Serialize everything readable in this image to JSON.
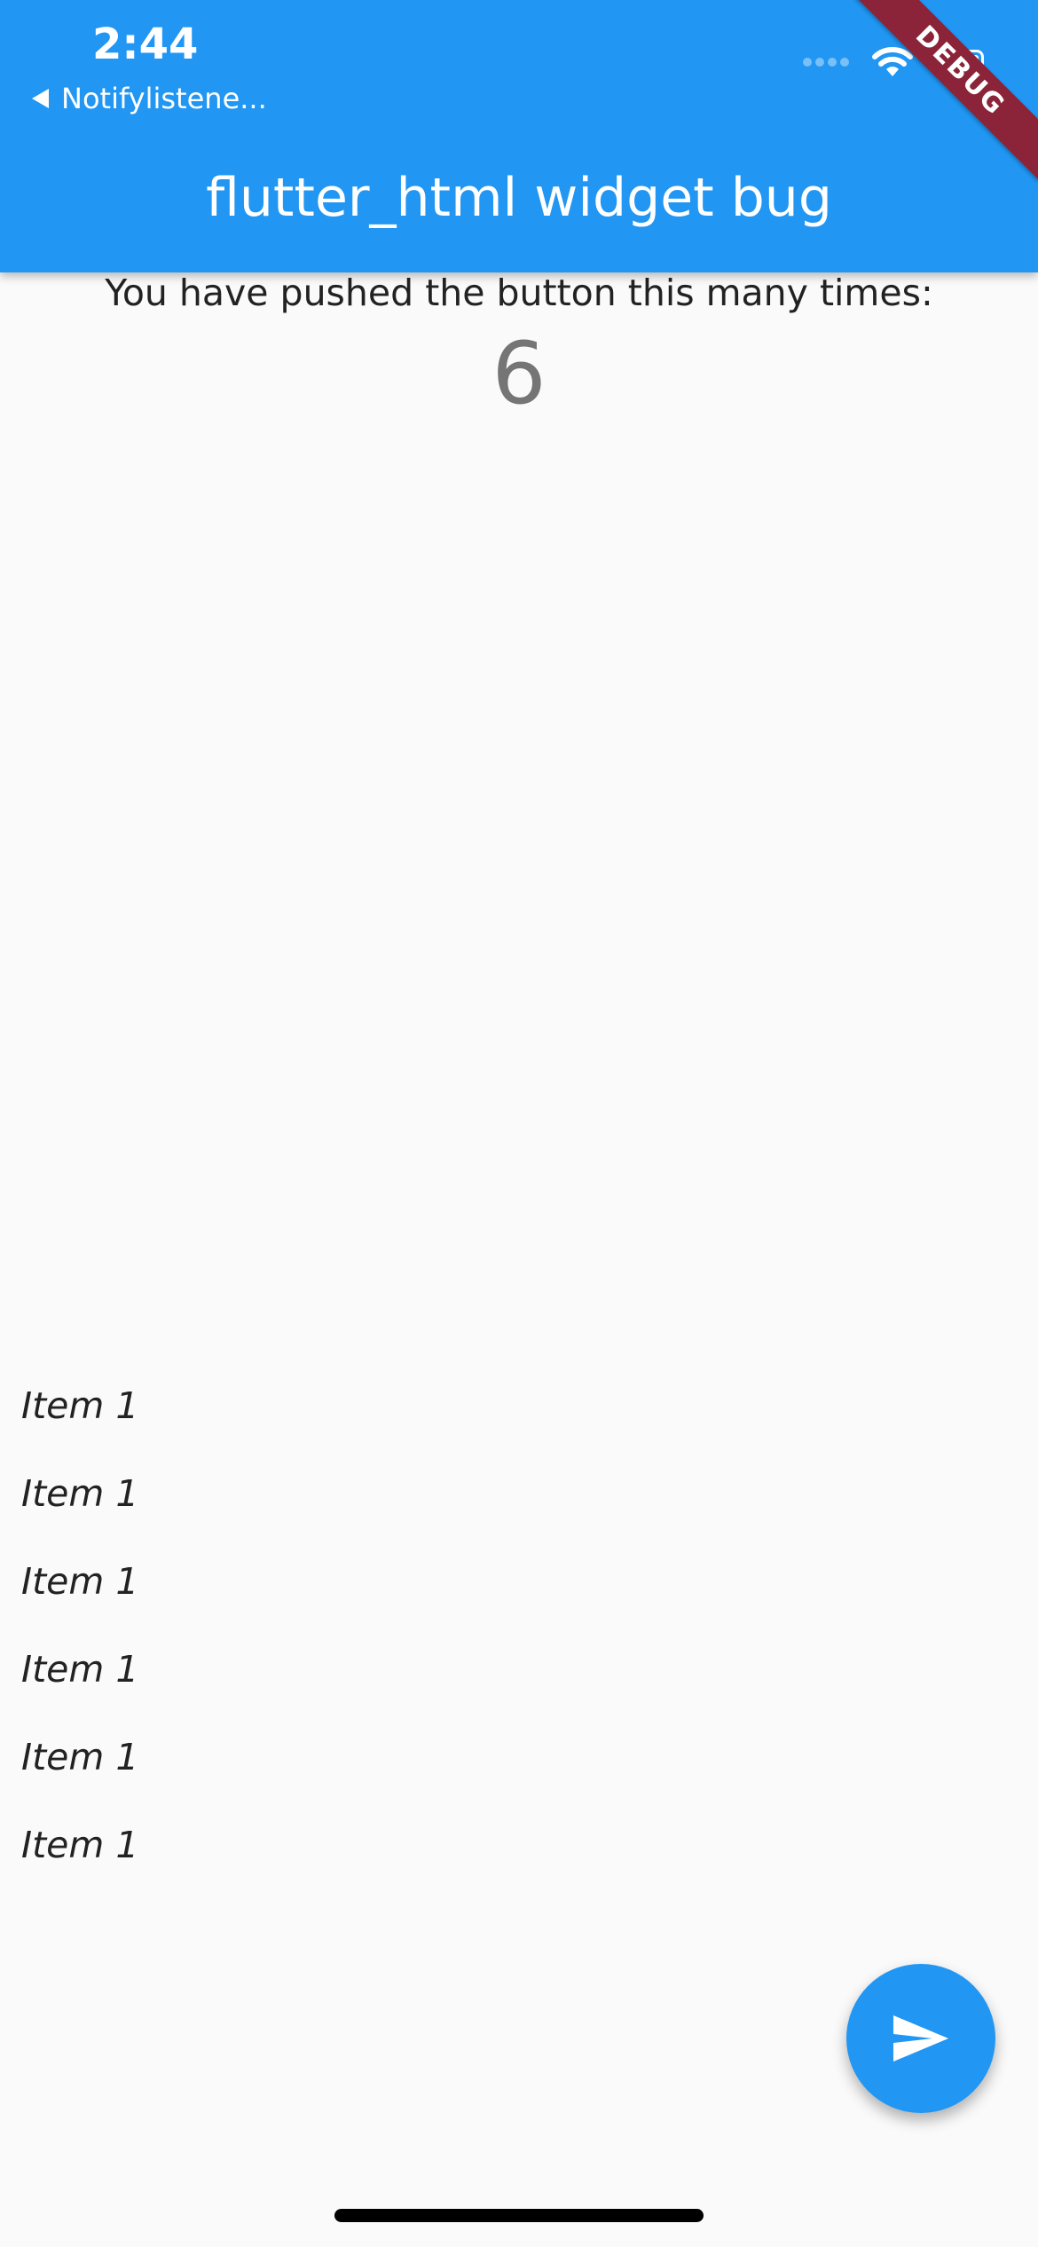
{
  "status_bar": {
    "time": "2:44",
    "back_app": "Notifylistene...",
    "icons": [
      "signal-icon",
      "wifi-icon",
      "battery-icon"
    ]
  },
  "app_bar": {
    "title": "flutter_html widget bug",
    "color": "#2196f3"
  },
  "debug_banner": {
    "label": "DEBUG",
    "color": "#8b2439"
  },
  "counter": {
    "label": "You have pushed the button this many times:",
    "value": "6"
  },
  "items": [
    "Item 1",
    "Item 1",
    "Item 1",
    "Item 1",
    "Item 1",
    "Item 1"
  ],
  "fab": {
    "icon": "send-icon",
    "color": "#2196f3"
  }
}
